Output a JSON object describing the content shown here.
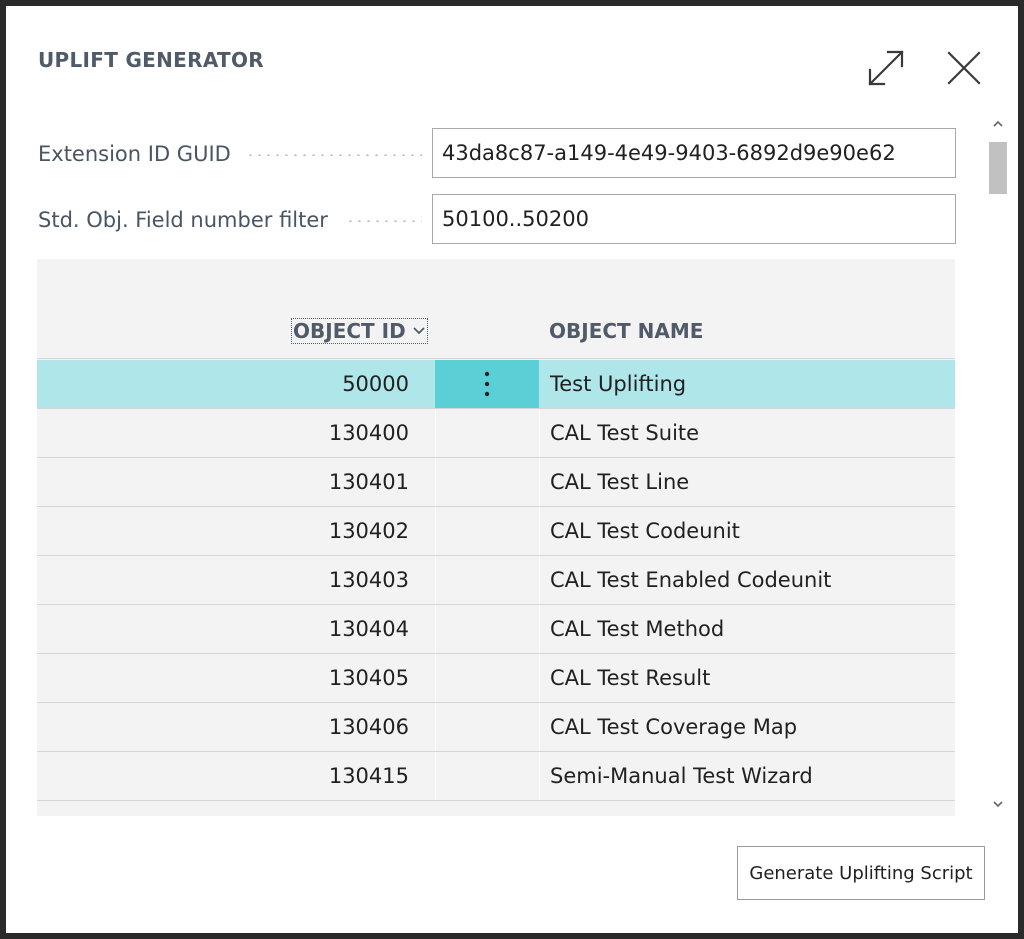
{
  "dialog": {
    "title": "UPLIFT GENERATOR",
    "expand_icon": "expand-icon",
    "close_icon": "close-icon"
  },
  "fields": {
    "extension_id": {
      "label": "Extension ID GUID",
      "value": "43da8c87-a149-4e49-9403-6892d9e90e62"
    },
    "field_filter": {
      "label": "Std. Obj. Field number filter",
      "value": "50100..50200"
    }
  },
  "grid": {
    "columns": {
      "object_id": "OBJECT ID",
      "object_name": "OBJECT NAME"
    },
    "sort_icon": "chevron-down-icon",
    "row_menu_icon": "vertical-ellipsis-icon",
    "rows": [
      {
        "id": "50000",
        "name": "Test Uplifting"
      },
      {
        "id": "130400",
        "name": "CAL Test Suite"
      },
      {
        "id": "130401",
        "name": "CAL Test Line"
      },
      {
        "id": "130402",
        "name": "CAL Test Codeunit"
      },
      {
        "id": "130403",
        "name": "CAL Test Enabled Codeunit"
      },
      {
        "id": "130404",
        "name": "CAL Test Method"
      },
      {
        "id": "130405",
        "name": "CAL Test Result"
      },
      {
        "id": "130406",
        "name": "CAL Test Coverage Map"
      },
      {
        "id": "130415",
        "name": "Semi-Manual Test Wizard"
      }
    ]
  },
  "actions": {
    "generate_label": "Generate Uplifting Script"
  },
  "colors": {
    "selected_row": "#aee6ea",
    "selected_actions": "#5ad0d6",
    "header_text": "#505a68"
  }
}
